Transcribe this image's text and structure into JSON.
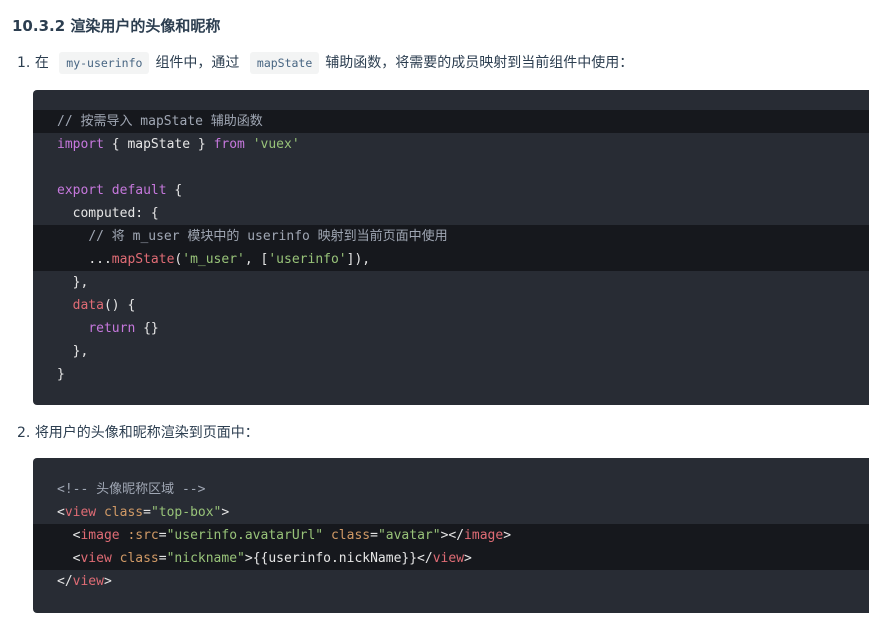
{
  "section": {
    "heading": "10.3.2 渲染用户的头像和昵称"
  },
  "step1": {
    "number": "1.",
    "text_before": "在",
    "code_component": "my-userinfo",
    "text_middle": "组件中，通过",
    "code_helper": "mapState",
    "text_after": "辅助函数，将需要的成员映射到当前组件中使用："
  },
  "code_block_1": {
    "lines": {
      "l1_comment": "// 按需导入 mapState 辅助函数",
      "l2_import": "import",
      "l2_brace_open": " { ",
      "l2_name": "mapState",
      "l2_brace_close": " } ",
      "l2_from": "from",
      "l2_space": " ",
      "l2_module": "'vuex'",
      "l4_export": "export",
      "l4_space": " ",
      "l4_default": "default",
      "l4_brace": " {",
      "l5_indent": "  ",
      "l5_computed": "computed",
      "l5_rest": ": {",
      "l6_indent": "    ",
      "l6_comment": "// 将 m_user 模块中的 userinfo 映射到当前页面中使用",
      "l7_indent": "    ",
      "l7_spread": "...",
      "l7_func": "mapState",
      "l7_paren_open": "(",
      "l7_arg1": "'m_user'",
      "l7_comma": ", [",
      "l7_arg2": "'userinfo'",
      "l7_close": "]),",
      "l8_text": "  },",
      "l9_indent": "  ",
      "l9_data": "data",
      "l9_rest": "() {",
      "l10_indent": "    ",
      "l10_return": "return",
      "l10_rest": " {}",
      "l11_text": "  },",
      "l12_text": "}"
    }
  },
  "step2": {
    "number": "2.",
    "text": "将用户的头像和昵称渲染到页面中："
  },
  "code_block_2": {
    "lines": {
      "l1_comment": "<!-- 头像昵称区域 -->",
      "l2_open": "<",
      "l2_tag": "view",
      "l2_space": " ",
      "l2_attr": "class",
      "l2_eq": "=",
      "l2_val": "\"top-box\"",
      "l2_close": ">",
      "l3_indent": "  ",
      "l3_open": "<",
      "l3_tag": "image",
      "l3_space1": " ",
      "l3_attr1": ":src",
      "l3_eq1": "=",
      "l3_val1": "\"userinfo.avatarUrl\"",
      "l3_space2": " ",
      "l3_attr2": "class",
      "l3_eq2": "=",
      "l3_val2": "\"avatar\"",
      "l3_mid": "></",
      "l3_tag_close": "image",
      "l3_end": ">",
      "l4_indent": "  ",
      "l4_open": "<",
      "l4_tag": "view",
      "l4_space": " ",
      "l4_attr": "class",
      "l4_eq": "=",
      "l4_val": "\"nickname\"",
      "l4_mid": ">{{userinfo.nickName}}</",
      "l4_tag_close": "view",
      "l4_end": ">",
      "l5_open": "</",
      "l5_tag": "view",
      "l5_end": ">"
    }
  }
}
